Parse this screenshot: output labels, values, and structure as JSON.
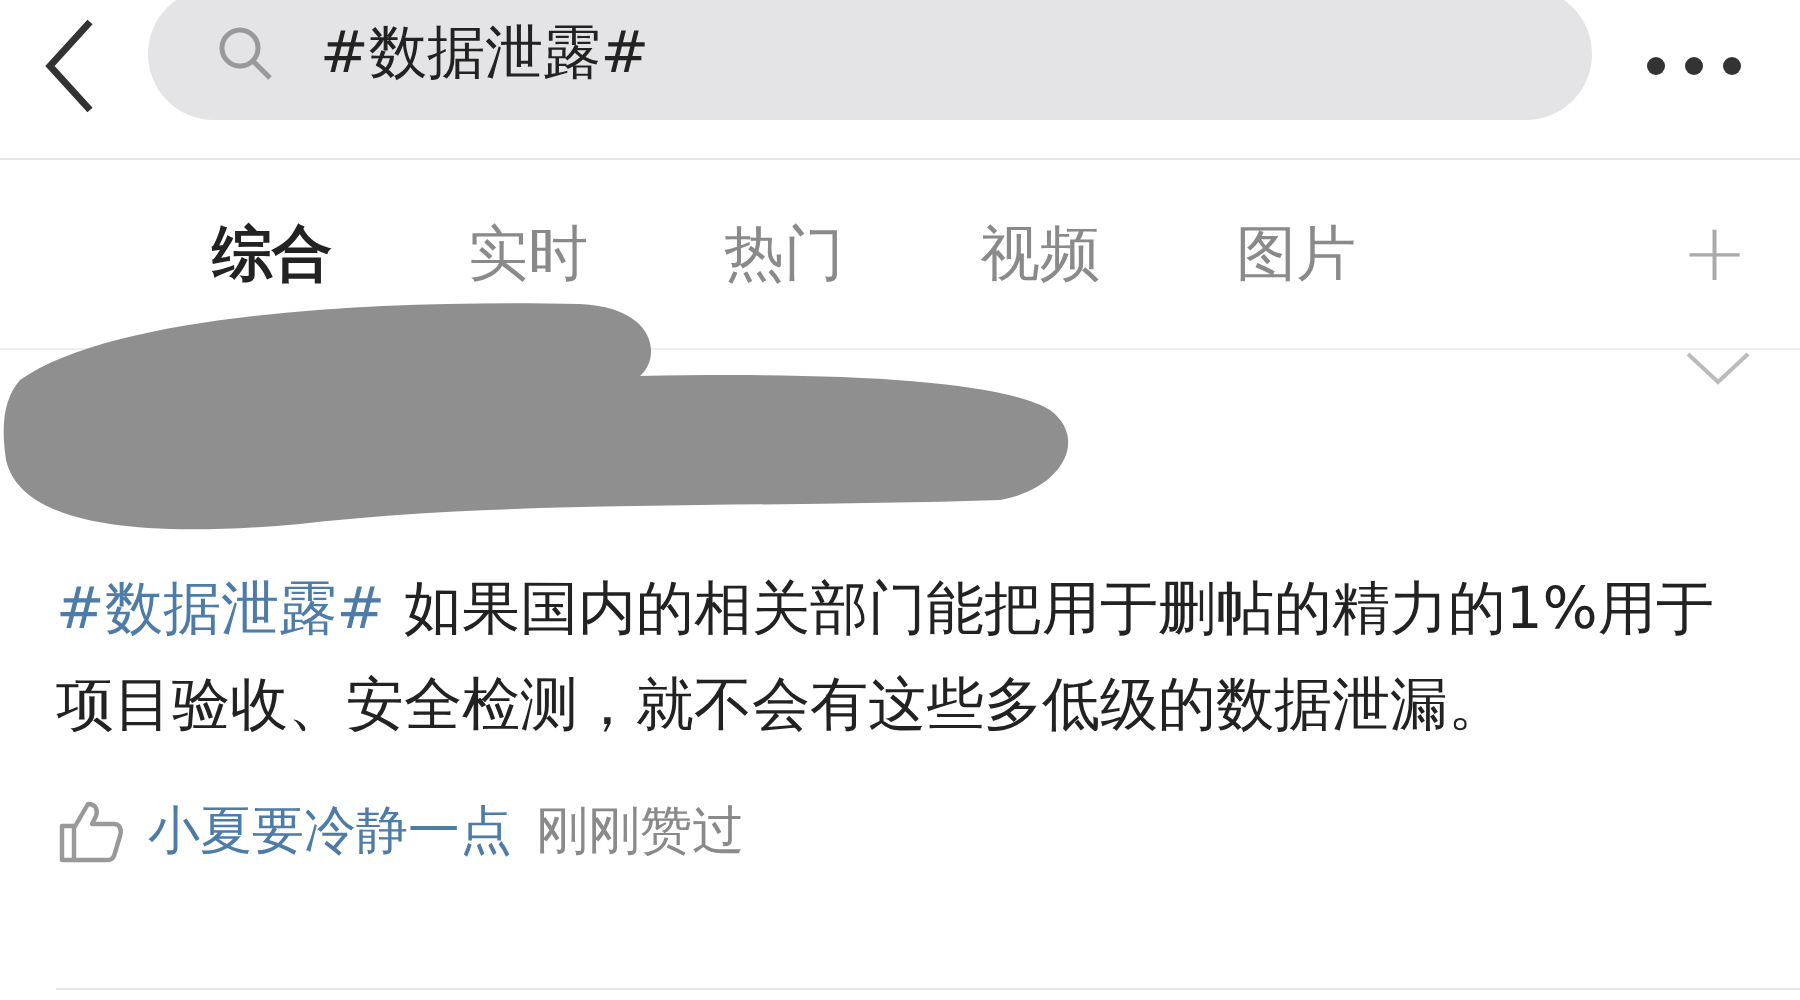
{
  "search": {
    "value": "#数据泄露#"
  },
  "tabs": [
    {
      "label": "综合",
      "selected": true
    },
    {
      "label": "实时",
      "selected": false
    },
    {
      "label": "热门",
      "selected": false
    },
    {
      "label": "视频",
      "selected": false
    },
    {
      "label": "图片",
      "selected": false
    }
  ],
  "add_tab": "+",
  "post": {
    "hashtag": "#数据泄露#",
    "text": "如果国内的相关部门能把用于删帖的精力的1%用于项目验收、安全检测，就不会有这些多低级的数据泄漏。"
  },
  "like": {
    "user": "小夏要冷静一点",
    "note": "刚刚赞过"
  }
}
